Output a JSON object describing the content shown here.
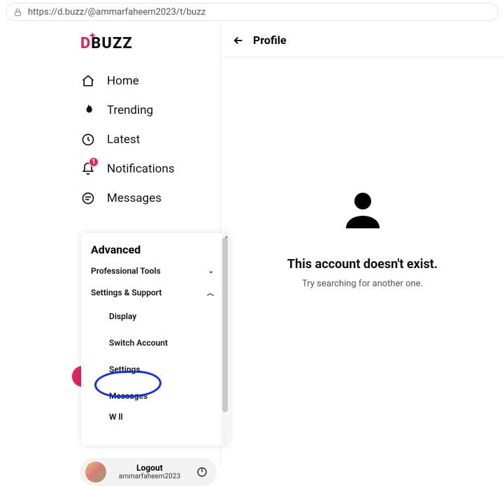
{
  "url": "https://d.buzz/@ammarfaheem2023/t/buzz",
  "logo": {
    "d": "D",
    "rest": "BUZZ"
  },
  "nav": {
    "home": "Home",
    "trending": "Trending",
    "latest": "Latest",
    "notifications": "Notifications",
    "notifications_badge": "1",
    "messages": "Messages"
  },
  "popup": {
    "heading": "Advanced",
    "pro_tools": "Professional Tools",
    "settings_support": "Settings & Support",
    "display": "Display",
    "switch_account": "Switch Account",
    "settings": "Settings",
    "messages": "Messages",
    "wallet_cut": "W  ll  "
  },
  "main": {
    "title": "Profile",
    "empty_title": "This account doesn't exist.",
    "empty_sub": "Try searching for another one."
  },
  "user": {
    "logout": "Logout",
    "handle": "ammarfaheem2023"
  }
}
